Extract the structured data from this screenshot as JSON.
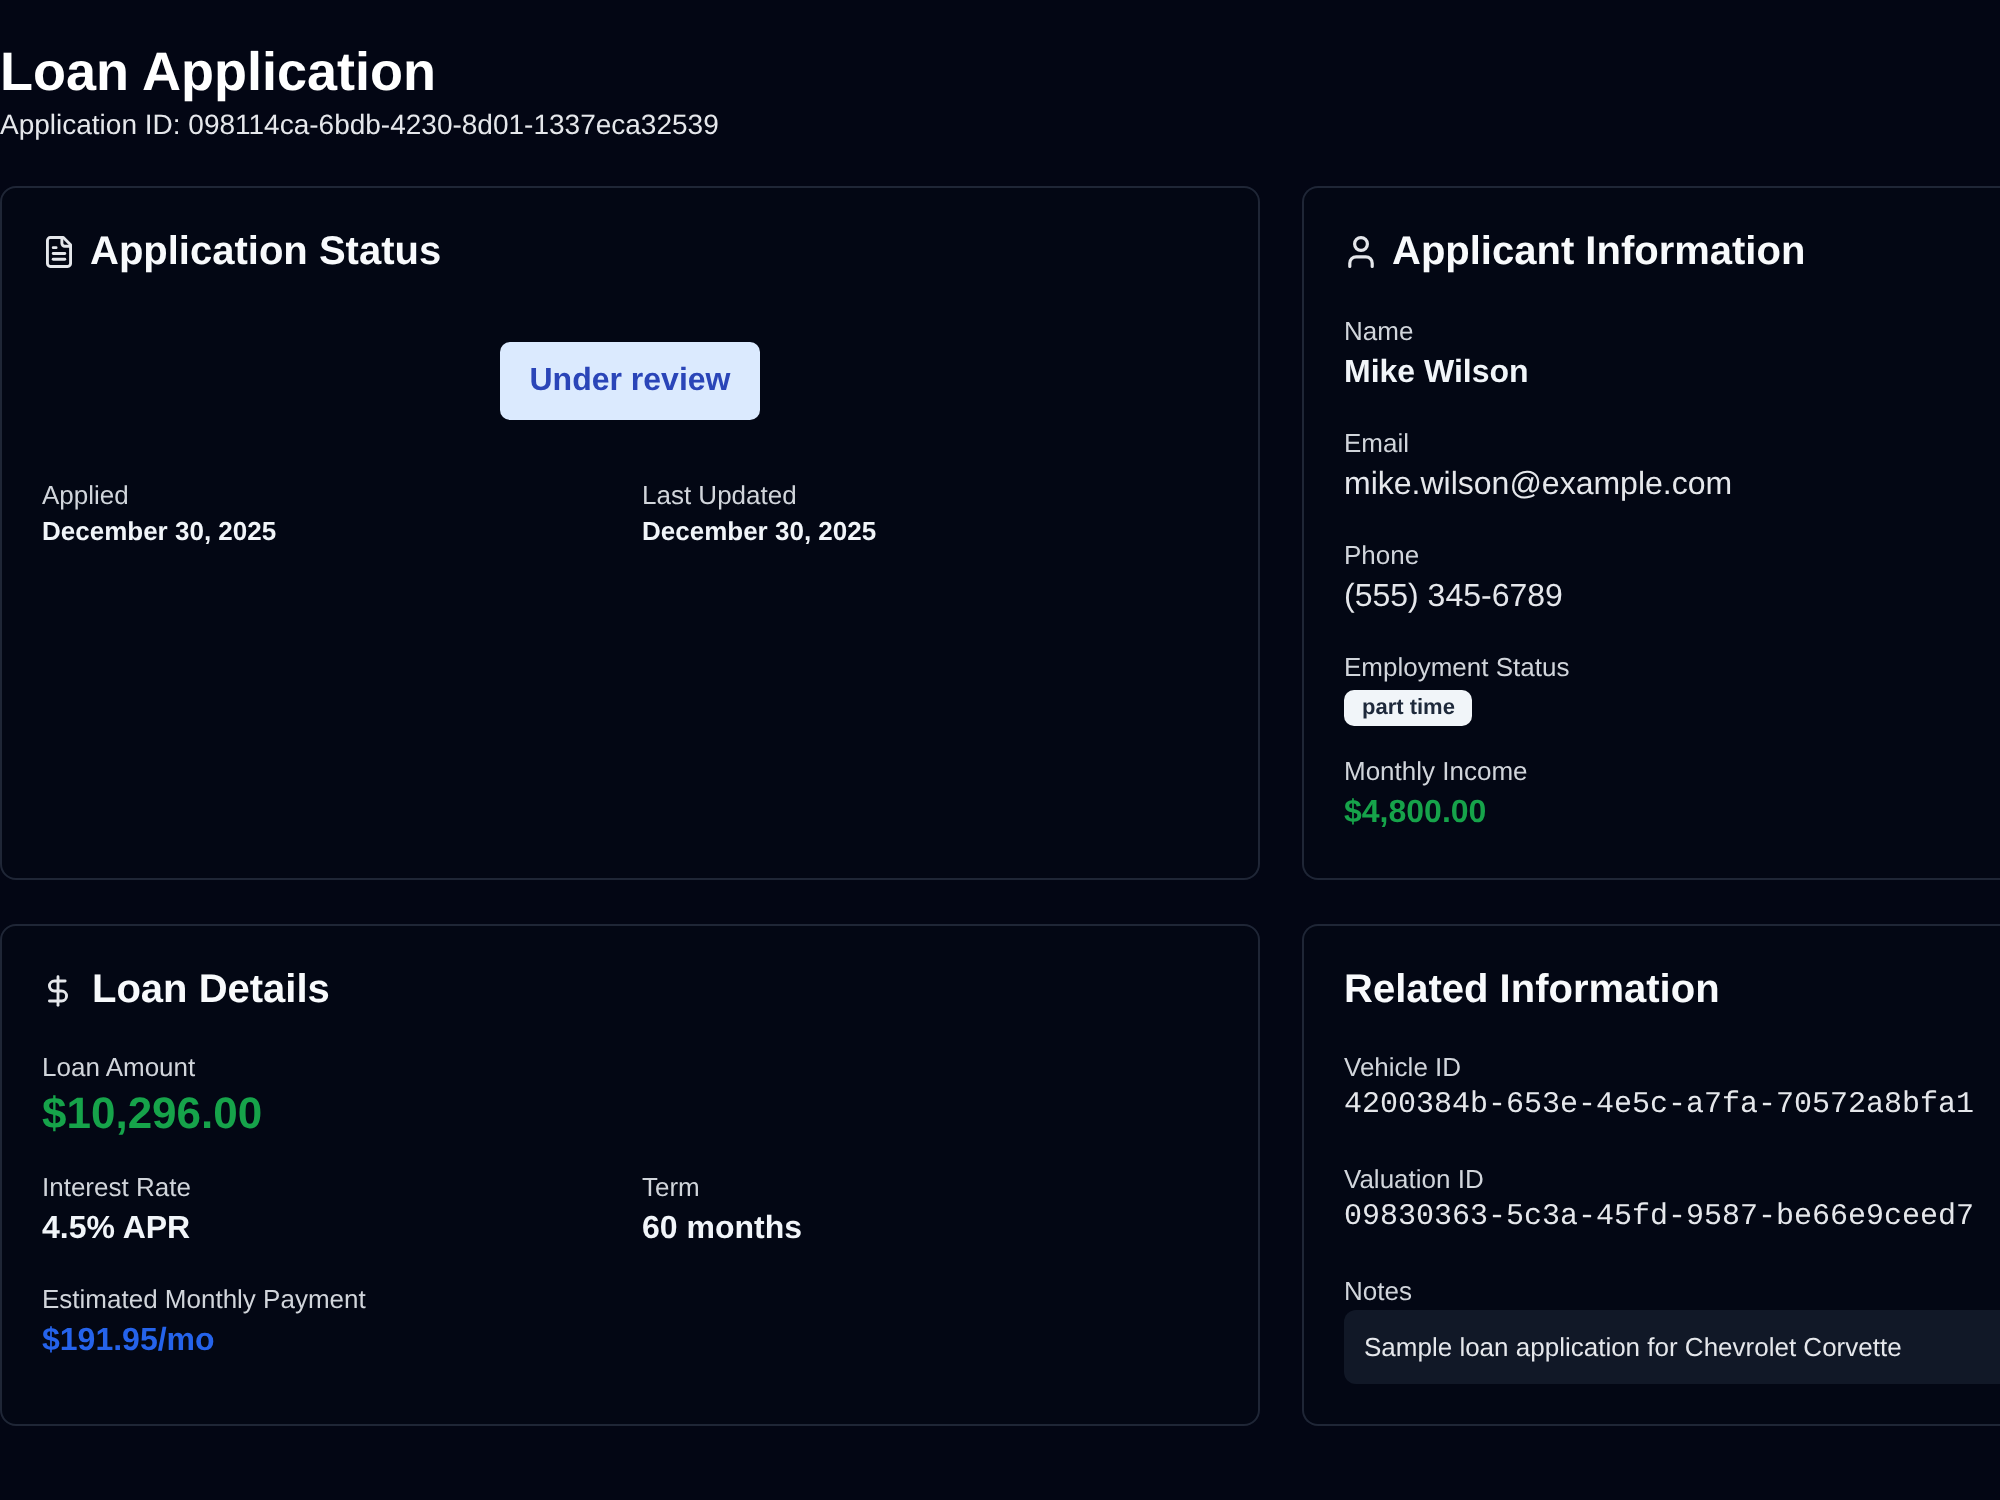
{
  "header": {
    "title": "Loan Application",
    "subtitle": "Application ID: 098114ca-6bdb-4230-8d01-1337eca32539"
  },
  "status_card": {
    "title": "Application Status",
    "status": "Under review",
    "dates": [
      {
        "label": "Applied",
        "value": "December 30, 2025"
      },
      {
        "label": "Last Updated",
        "value": "December 30, 2025"
      }
    ]
  },
  "applicant_card": {
    "title": "Applicant Information",
    "fields": [
      {
        "label": "Name",
        "value": "Mike Wilson",
        "kind": "name"
      },
      {
        "label": "Email",
        "value": "mike.wilson@example.com",
        "kind": "text"
      },
      {
        "label": "Phone",
        "value": "(555) 345-6789",
        "kind": "text"
      },
      {
        "label": "Employment Status",
        "value": "part time",
        "kind": "badge"
      },
      {
        "label": "Monthly Income",
        "value": "$4,800.00",
        "kind": "income"
      }
    ]
  },
  "loan_card": {
    "title": "Loan Details",
    "fields": [
      {
        "label": "Loan Amount",
        "value": "$10,296.00",
        "kind": "amount"
      },
      {
        "label": "Interest Rate",
        "value": "4.5% APR",
        "kind": "strong"
      },
      {
        "label": "Term",
        "value": "60 months",
        "kind": "strong"
      },
      {
        "label": "Estimated Monthly Payment",
        "value": "$191.95/mo",
        "kind": "payment"
      }
    ]
  },
  "related_card": {
    "title": "Related Information",
    "fields": [
      {
        "label": "Vehicle ID",
        "value": "4200384b-653e-4e5c-a7fa-70572a8bfa1",
        "kind": "mono"
      },
      {
        "label": "Valuation ID",
        "value": "09830363-5c3a-45fd-9587-be66e9ceed7",
        "kind": "mono"
      },
      {
        "label": "Notes",
        "value": "Sample loan application for Chevrolet Corvette",
        "kind": "note"
      }
    ]
  }
}
